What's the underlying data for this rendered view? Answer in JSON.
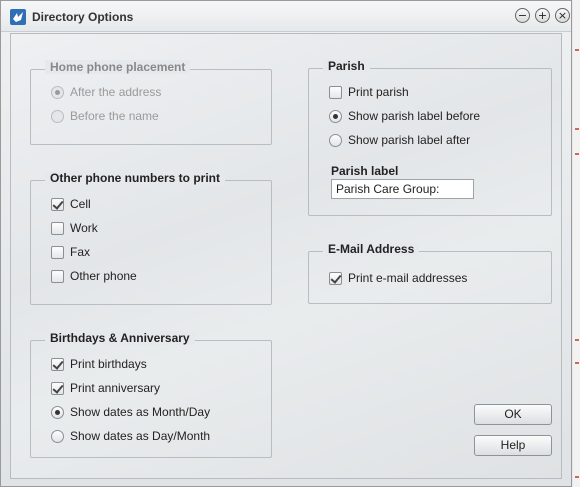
{
  "window": {
    "title": "Directory Options",
    "controls": {
      "minimize": "−",
      "maximize": "+",
      "close": "×"
    }
  },
  "home_phone": {
    "title": "Home phone placement",
    "options": [
      {
        "label": "After the address",
        "selected": true
      },
      {
        "label": "Before the name",
        "selected": false
      }
    ]
  },
  "other_phones": {
    "title": "Other phone numbers to print",
    "options": [
      {
        "label": "Cell",
        "checked": true
      },
      {
        "label": "Work",
        "checked": false
      },
      {
        "label": "Fax",
        "checked": false
      },
      {
        "label": "Other phone",
        "checked": false
      }
    ]
  },
  "birthdays": {
    "title": "Birthdays & Anniversary",
    "options": [
      {
        "label": "Print birthdays",
        "checked": true
      },
      {
        "label": "Print anniversary",
        "checked": true
      },
      {
        "label": "Show dates as Month/Day",
        "selected": true
      },
      {
        "label": "Show dates as Day/Month",
        "selected": false
      }
    ]
  },
  "parish": {
    "title": "Parish",
    "options": [
      {
        "label": "Print parish",
        "checked": false
      },
      {
        "label": "Show parish label before",
        "selected": true
      },
      {
        "label": "Show parish label after",
        "selected": false
      }
    ],
    "label_title": "Parish label",
    "label_value": "Parish Care Group:"
  },
  "email": {
    "title": "E-Mail Address",
    "options": [
      {
        "label": "Print e-mail addresses",
        "checked": true
      }
    ]
  },
  "buttons": {
    "ok": "OK",
    "help": "Help"
  }
}
